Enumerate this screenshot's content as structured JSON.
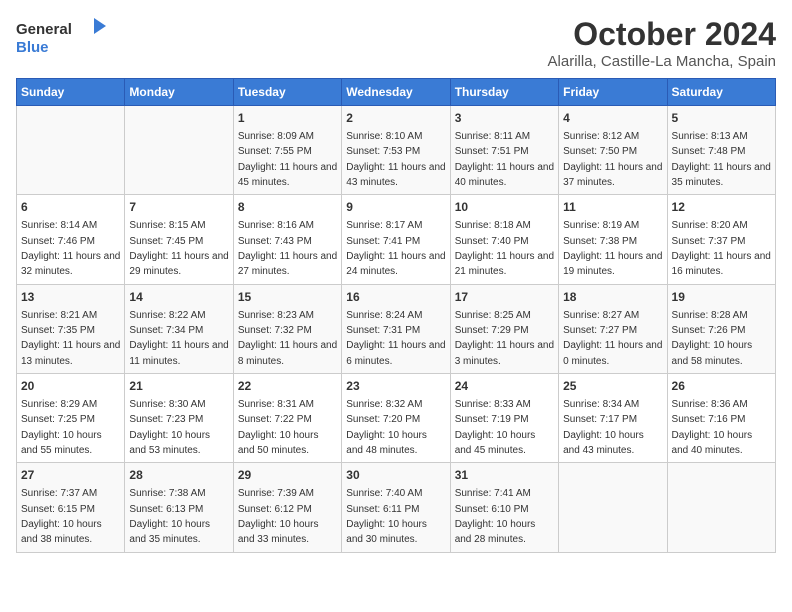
{
  "logo": {
    "general": "General",
    "blue": "Blue"
  },
  "title": "October 2024",
  "subtitle": "Alarilla, Castille-La Mancha, Spain",
  "weekdays": [
    "Sunday",
    "Monday",
    "Tuesday",
    "Wednesday",
    "Thursday",
    "Friday",
    "Saturday"
  ],
  "weeks": [
    [
      {
        "day": "",
        "sunrise": "",
        "sunset": "",
        "daylight": ""
      },
      {
        "day": "",
        "sunrise": "",
        "sunset": "",
        "daylight": ""
      },
      {
        "day": "1",
        "sunrise": "Sunrise: 8:09 AM",
        "sunset": "Sunset: 7:55 PM",
        "daylight": "Daylight: 11 hours and 45 minutes."
      },
      {
        "day": "2",
        "sunrise": "Sunrise: 8:10 AM",
        "sunset": "Sunset: 7:53 PM",
        "daylight": "Daylight: 11 hours and 43 minutes."
      },
      {
        "day": "3",
        "sunrise": "Sunrise: 8:11 AM",
        "sunset": "Sunset: 7:51 PM",
        "daylight": "Daylight: 11 hours and 40 minutes."
      },
      {
        "day": "4",
        "sunrise": "Sunrise: 8:12 AM",
        "sunset": "Sunset: 7:50 PM",
        "daylight": "Daylight: 11 hours and 37 minutes."
      },
      {
        "day": "5",
        "sunrise": "Sunrise: 8:13 AM",
        "sunset": "Sunset: 7:48 PM",
        "daylight": "Daylight: 11 hours and 35 minutes."
      }
    ],
    [
      {
        "day": "6",
        "sunrise": "Sunrise: 8:14 AM",
        "sunset": "Sunset: 7:46 PM",
        "daylight": "Daylight: 11 hours and 32 minutes."
      },
      {
        "day": "7",
        "sunrise": "Sunrise: 8:15 AM",
        "sunset": "Sunset: 7:45 PM",
        "daylight": "Daylight: 11 hours and 29 minutes."
      },
      {
        "day": "8",
        "sunrise": "Sunrise: 8:16 AM",
        "sunset": "Sunset: 7:43 PM",
        "daylight": "Daylight: 11 hours and 27 minutes."
      },
      {
        "day": "9",
        "sunrise": "Sunrise: 8:17 AM",
        "sunset": "Sunset: 7:41 PM",
        "daylight": "Daylight: 11 hours and 24 minutes."
      },
      {
        "day": "10",
        "sunrise": "Sunrise: 8:18 AM",
        "sunset": "Sunset: 7:40 PM",
        "daylight": "Daylight: 11 hours and 21 minutes."
      },
      {
        "day": "11",
        "sunrise": "Sunrise: 8:19 AM",
        "sunset": "Sunset: 7:38 PM",
        "daylight": "Daylight: 11 hours and 19 minutes."
      },
      {
        "day": "12",
        "sunrise": "Sunrise: 8:20 AM",
        "sunset": "Sunset: 7:37 PM",
        "daylight": "Daylight: 11 hours and 16 minutes."
      }
    ],
    [
      {
        "day": "13",
        "sunrise": "Sunrise: 8:21 AM",
        "sunset": "Sunset: 7:35 PM",
        "daylight": "Daylight: 11 hours and 13 minutes."
      },
      {
        "day": "14",
        "sunrise": "Sunrise: 8:22 AM",
        "sunset": "Sunset: 7:34 PM",
        "daylight": "Daylight: 11 hours and 11 minutes."
      },
      {
        "day": "15",
        "sunrise": "Sunrise: 8:23 AM",
        "sunset": "Sunset: 7:32 PM",
        "daylight": "Daylight: 11 hours and 8 minutes."
      },
      {
        "day": "16",
        "sunrise": "Sunrise: 8:24 AM",
        "sunset": "Sunset: 7:31 PM",
        "daylight": "Daylight: 11 hours and 6 minutes."
      },
      {
        "day": "17",
        "sunrise": "Sunrise: 8:25 AM",
        "sunset": "Sunset: 7:29 PM",
        "daylight": "Daylight: 11 hours and 3 minutes."
      },
      {
        "day": "18",
        "sunrise": "Sunrise: 8:27 AM",
        "sunset": "Sunset: 7:27 PM",
        "daylight": "Daylight: 11 hours and 0 minutes."
      },
      {
        "day": "19",
        "sunrise": "Sunrise: 8:28 AM",
        "sunset": "Sunset: 7:26 PM",
        "daylight": "Daylight: 10 hours and 58 minutes."
      }
    ],
    [
      {
        "day": "20",
        "sunrise": "Sunrise: 8:29 AM",
        "sunset": "Sunset: 7:25 PM",
        "daylight": "Daylight: 10 hours and 55 minutes."
      },
      {
        "day": "21",
        "sunrise": "Sunrise: 8:30 AM",
        "sunset": "Sunset: 7:23 PM",
        "daylight": "Daylight: 10 hours and 53 minutes."
      },
      {
        "day": "22",
        "sunrise": "Sunrise: 8:31 AM",
        "sunset": "Sunset: 7:22 PM",
        "daylight": "Daylight: 10 hours and 50 minutes."
      },
      {
        "day": "23",
        "sunrise": "Sunrise: 8:32 AM",
        "sunset": "Sunset: 7:20 PM",
        "daylight": "Daylight: 10 hours and 48 minutes."
      },
      {
        "day": "24",
        "sunrise": "Sunrise: 8:33 AM",
        "sunset": "Sunset: 7:19 PM",
        "daylight": "Daylight: 10 hours and 45 minutes."
      },
      {
        "day": "25",
        "sunrise": "Sunrise: 8:34 AM",
        "sunset": "Sunset: 7:17 PM",
        "daylight": "Daylight: 10 hours and 43 minutes."
      },
      {
        "day": "26",
        "sunrise": "Sunrise: 8:36 AM",
        "sunset": "Sunset: 7:16 PM",
        "daylight": "Daylight: 10 hours and 40 minutes."
      }
    ],
    [
      {
        "day": "27",
        "sunrise": "Sunrise: 7:37 AM",
        "sunset": "Sunset: 6:15 PM",
        "daylight": "Daylight: 10 hours and 38 minutes."
      },
      {
        "day": "28",
        "sunrise": "Sunrise: 7:38 AM",
        "sunset": "Sunset: 6:13 PM",
        "daylight": "Daylight: 10 hours and 35 minutes."
      },
      {
        "day": "29",
        "sunrise": "Sunrise: 7:39 AM",
        "sunset": "Sunset: 6:12 PM",
        "daylight": "Daylight: 10 hours and 33 minutes."
      },
      {
        "day": "30",
        "sunrise": "Sunrise: 7:40 AM",
        "sunset": "Sunset: 6:11 PM",
        "daylight": "Daylight: 10 hours and 30 minutes."
      },
      {
        "day": "31",
        "sunrise": "Sunrise: 7:41 AM",
        "sunset": "Sunset: 6:10 PM",
        "daylight": "Daylight: 10 hours and 28 minutes."
      },
      {
        "day": "",
        "sunrise": "",
        "sunset": "",
        "daylight": ""
      },
      {
        "day": "",
        "sunrise": "",
        "sunset": "",
        "daylight": ""
      }
    ]
  ]
}
